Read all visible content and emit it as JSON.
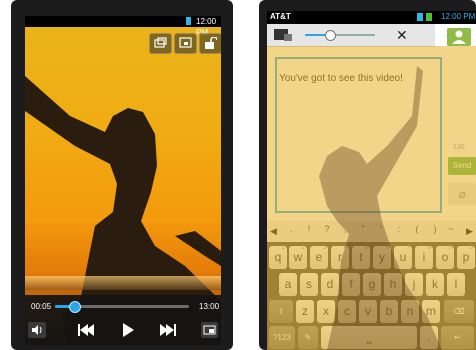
{
  "left_player": {
    "status_time": "12:00 PM",
    "top_icons": [
      "window-mode-icon",
      "screen-capture-icon",
      "unlock-icon"
    ],
    "progress": {
      "current": "00:05",
      "total": "13:00",
      "fraction": 0.14
    },
    "controls": [
      "volume-icon",
      "rewind-icon",
      "play-icon",
      "fast-forward-icon",
      "popup-player-icon"
    ]
  },
  "right_messaging": {
    "status_carrier": "AT&T",
    "status_time": "12:00 PM",
    "pip_progress_fraction": 0.35,
    "close_label": "✕",
    "message_text": "You've got to see this video!",
    "char_counter": "130",
    "send_label": "Send",
    "symbol_row": [
      ".",
      "!",
      "?",
      ",",
      "\"",
      "'",
      ":",
      "(",
      ")",
      "~"
    ],
    "keyboard": {
      "row1": [
        "q",
        "w",
        "e",
        "r",
        "t",
        "y",
        "u",
        "i",
        "o",
        "p"
      ],
      "row1_sub": [
        "1",
        "2",
        "3",
        "4",
        "5",
        "6",
        "7",
        "8",
        "9",
        "0"
      ],
      "row2": [
        "a",
        "s",
        "d",
        "f",
        "g",
        "h",
        "j",
        "k",
        "l"
      ],
      "row3": [
        "z",
        "x",
        "c",
        "v",
        "b",
        "n",
        "m"
      ],
      "row4_sym_label": "?123"
    }
  }
}
